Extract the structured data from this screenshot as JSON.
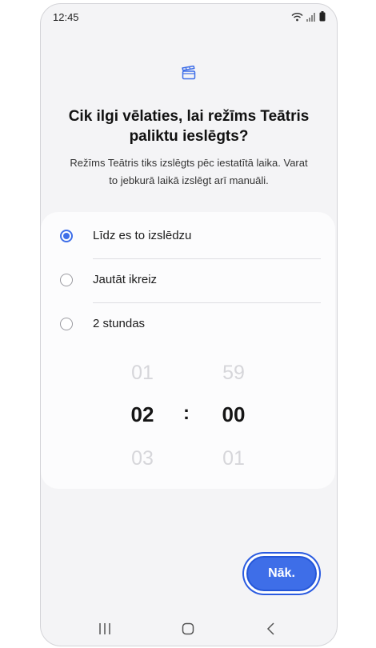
{
  "status_bar": {
    "time": "12:45",
    "icons": [
      "wifi-icon",
      "signal-icon",
      "battery-icon"
    ]
  },
  "header": {
    "icon": "clapperboard-icon",
    "title_line1": "Cik ilgi vēlaties, lai režīms Teātris",
    "title_line2": "paliktu ieslēgts?",
    "subtitle_line1": "Režīms Teātris tiks izslēgts pēc iestatītā laika. Varat",
    "subtitle_line2": "to jebkurā laikā izslēgt arī manuāli."
  },
  "options": [
    {
      "label": "Līdz es to izslēdzu",
      "selected": true
    },
    {
      "label": "Jautāt ikreiz",
      "selected": false
    },
    {
      "label": "2 stundas",
      "selected": false
    }
  ],
  "time_picker": {
    "hours": {
      "prev": "01",
      "current": "02",
      "next": "03"
    },
    "separator": ":",
    "minutes": {
      "prev": "59",
      "current": "00",
      "next": "01"
    }
  },
  "next_button": {
    "label": "Nāk."
  },
  "nav_bar": {
    "items": [
      "recent-apps-icon",
      "home-icon",
      "back-icon"
    ]
  },
  "colors": {
    "accent": "#3e6ee8",
    "background": "#f4f4f6",
    "card": "#fcfcfd"
  }
}
